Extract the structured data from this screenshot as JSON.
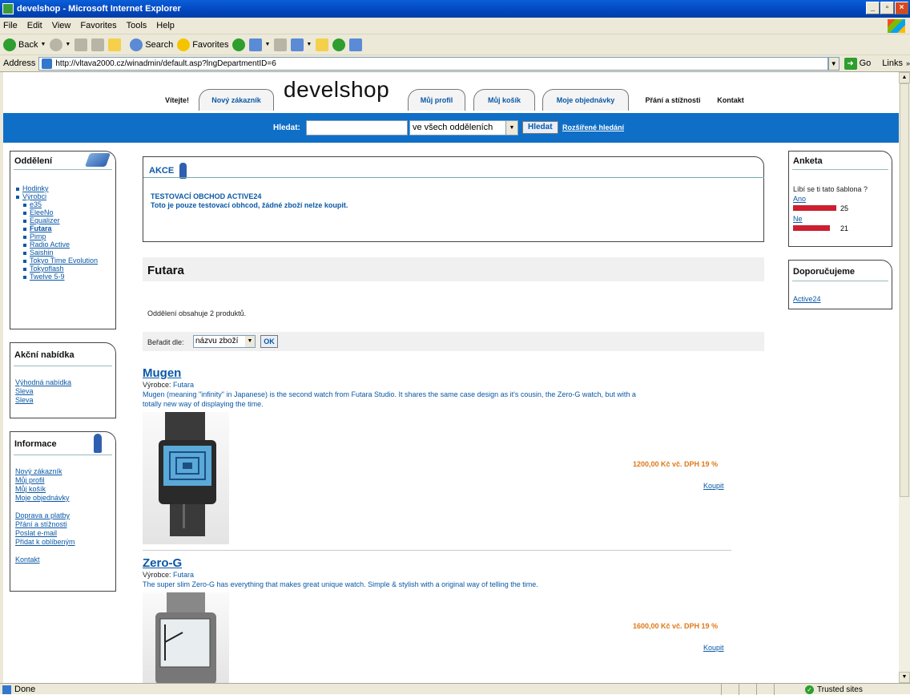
{
  "window": {
    "title": "develshop - Microsoft Internet Explorer",
    "menu": [
      "File",
      "Edit",
      "View",
      "Favorites",
      "Tools",
      "Help"
    ],
    "toolbar": {
      "back": "Back",
      "search": "Search",
      "favorites": "Favorites"
    },
    "address_label": "Address",
    "url": "http://vltava2000.cz/winadmin/default.asp?lngDepartmentID=6",
    "go_label": "Go",
    "links_label": "Links",
    "status": "Done",
    "zone": "Trusted sites"
  },
  "site": {
    "logo": "develshop",
    "nav": [
      "Vítejte!",
      "Nový zákazník",
      "Můj profil",
      "Můj košík",
      "Moje objednávky",
      "Přání a stížnosti",
      "Kontakt"
    ],
    "search": {
      "label": "Hledat:",
      "scope": "ve všech odděleních",
      "button": "Hledat",
      "advanced": "Rozšířené hledání"
    }
  },
  "left": {
    "departments": {
      "title": "Oddělení",
      "items": [
        {
          "label": "Hodinky",
          "level": 1
        },
        {
          "label": "Výrobci",
          "level": 1
        },
        {
          "label": "e35",
          "level": 2
        },
        {
          "label": "EleeNo",
          "level": 2
        },
        {
          "label": "Equalizer",
          "level": 2
        },
        {
          "label": "Futara",
          "level": 2,
          "active": true
        },
        {
          "label": "Pimp",
          "level": 2
        },
        {
          "label": "Radio Active",
          "level": 2
        },
        {
          "label": "Saishin",
          "level": 2
        },
        {
          "label": "Tokyo Time Evolution",
          "level": 2
        },
        {
          "label": "Tokyoflash",
          "level": 2
        },
        {
          "label": "Twelve 5-9",
          "level": 2
        }
      ]
    },
    "offers": {
      "title": "Akční nabídka",
      "items": [
        "Výhodná nabídka",
        "Sleva",
        "Sleva"
      ]
    },
    "info": {
      "title": "Informace",
      "group1": [
        "Nový zákazník",
        "Můj profil",
        "Můj košík",
        "Moje objednávky"
      ],
      "group2": [
        "Doprava a platby",
        "Přání a stížnosti",
        "Poslat e-mail",
        "Přidat k oblíbeným"
      ],
      "group3": [
        "Kontakt"
      ]
    }
  },
  "main": {
    "akce": {
      "title": "AKCE",
      "heading": "TESTOVACÍ OBCHOD ACTIVE24",
      "text": "Toto je pouze testovací obhcod, žádné zboží nelze koupit."
    },
    "department_title": "Futara",
    "count_text": "Oddělení obsahuje 2 produktů.",
    "sort": {
      "label": "Beřadit dle:",
      "value": "názvu zboží",
      "button": "OK"
    },
    "products": [
      {
        "name": "Mugen",
        "maker_label": "Výrobce:",
        "maker": "Futara",
        "description": "Mugen (meaning \"infinity\" in Japanese) is the second watch from Futara Studio. It shares the same case design as it's cousin, the Zero-G watch, but with a totally new way of displaying the time.",
        "price": "1200,00 Kč vč. DPH 19 %",
        "buy": "Koupit"
      },
      {
        "name": "Zero-G",
        "maker_label": "Výrobce:",
        "maker": "Futara",
        "description": "The super slim Zero-G has everything that makes great unique watch. Simple & stylish with a original way of telling the time.",
        "price": "1600,00 Kč vč. DPH 19 %",
        "buy": "Koupit"
      }
    ]
  },
  "right": {
    "poll": {
      "title": "Anketa",
      "question": "Líbí se ti tato šablona ?",
      "options": [
        {
          "label": "Ano",
          "votes": "25",
          "share": 0.54
        },
        {
          "label": "Ne",
          "votes": "21",
          "share": 0.46
        }
      ]
    },
    "recommend": {
      "title": "Doporučujeme",
      "items": [
        "Active24"
      ]
    }
  },
  "colors": {
    "accent": "#0f6fc6",
    "link": "#0a58a6",
    "price": "#e07818",
    "poll_bar": "#cc1f2f"
  }
}
